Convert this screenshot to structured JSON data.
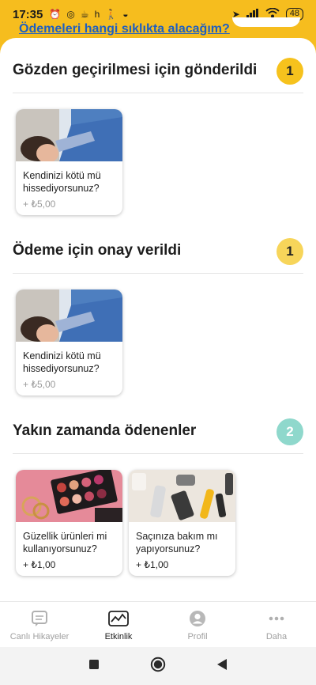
{
  "status_bar": {
    "time": "17:35",
    "left_icons": [
      "alarm-icon",
      "whatsapp-icon",
      "cup-icon",
      "h",
      "walking-icon",
      "pokeball-icon"
    ],
    "battery": "48"
  },
  "header": {
    "link": "Ödemeleri hangi sıklıkta alacağım?",
    "accent": "#f6bd1e"
  },
  "sections": [
    {
      "title": "Gözden geçirilmesi için gönderildi",
      "count": "1",
      "badge_color": "#f6c21d",
      "cards": [
        {
          "title": "Kendinizi kötü mü hissediyorsunuz?",
          "amount": "+ ₺5,00",
          "image": "sick-person-photo"
        }
      ]
    },
    {
      "title": "Ödeme için onay verildi",
      "count": "1",
      "badge_color": "#f7d55a",
      "cards": [
        {
          "title": "Kendinizi kötü mü hissediyorsunuz?",
          "amount": "+ ₺5,00",
          "image": "sick-person-photo"
        }
      ]
    },
    {
      "title": "Yakın zamanda ödenenler",
      "count": "2",
      "badge_color": "#8fd8cc",
      "cards": [
        {
          "title": "Güzellik ürünleri mi kullanıyorsunuz?",
          "amount": "+ ₺1,00",
          "image": "makeup-palette-photo"
        },
        {
          "title": "Saçınıza bakım mı yapıyorsunuz?",
          "amount": "+ ₺1,00",
          "image": "hair-care-products-photo"
        }
      ]
    }
  ],
  "bottom_nav": [
    {
      "label": "Canlı Hikayeler",
      "icon": "stories-icon",
      "active": false
    },
    {
      "label": "Etkinlik",
      "icon": "activity-chart-icon",
      "active": true
    },
    {
      "label": "Profil",
      "icon": "profile-icon",
      "active": false
    },
    {
      "label": "Daha",
      "icon": "more-icon",
      "active": false
    }
  ],
  "system_nav": [
    "recents-square-icon",
    "home-circle-icon",
    "back-triangle-icon"
  ]
}
